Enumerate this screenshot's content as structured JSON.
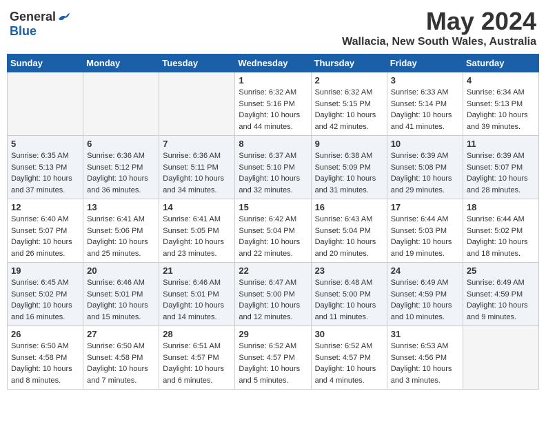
{
  "header": {
    "logo_general": "General",
    "logo_blue": "Blue",
    "month_title": "May 2024",
    "location": "Wallacia, New South Wales, Australia"
  },
  "calendar": {
    "days_of_week": [
      "Sunday",
      "Monday",
      "Tuesday",
      "Wednesday",
      "Thursday",
      "Friday",
      "Saturday"
    ],
    "weeks": [
      [
        {
          "day": "",
          "info": ""
        },
        {
          "day": "",
          "info": ""
        },
        {
          "day": "",
          "info": ""
        },
        {
          "day": "1",
          "info": "Sunrise: 6:32 AM\nSunset: 5:16 PM\nDaylight: 10 hours\nand 44 minutes."
        },
        {
          "day": "2",
          "info": "Sunrise: 6:32 AM\nSunset: 5:15 PM\nDaylight: 10 hours\nand 42 minutes."
        },
        {
          "day": "3",
          "info": "Sunrise: 6:33 AM\nSunset: 5:14 PM\nDaylight: 10 hours\nand 41 minutes."
        },
        {
          "day": "4",
          "info": "Sunrise: 6:34 AM\nSunset: 5:13 PM\nDaylight: 10 hours\nand 39 minutes."
        }
      ],
      [
        {
          "day": "5",
          "info": "Sunrise: 6:35 AM\nSunset: 5:13 PM\nDaylight: 10 hours\nand 37 minutes."
        },
        {
          "day": "6",
          "info": "Sunrise: 6:36 AM\nSunset: 5:12 PM\nDaylight: 10 hours\nand 36 minutes."
        },
        {
          "day": "7",
          "info": "Sunrise: 6:36 AM\nSunset: 5:11 PM\nDaylight: 10 hours\nand 34 minutes."
        },
        {
          "day": "8",
          "info": "Sunrise: 6:37 AM\nSunset: 5:10 PM\nDaylight: 10 hours\nand 32 minutes."
        },
        {
          "day": "9",
          "info": "Sunrise: 6:38 AM\nSunset: 5:09 PM\nDaylight: 10 hours\nand 31 minutes."
        },
        {
          "day": "10",
          "info": "Sunrise: 6:39 AM\nSunset: 5:08 PM\nDaylight: 10 hours\nand 29 minutes."
        },
        {
          "day": "11",
          "info": "Sunrise: 6:39 AM\nSunset: 5:07 PM\nDaylight: 10 hours\nand 28 minutes."
        }
      ],
      [
        {
          "day": "12",
          "info": "Sunrise: 6:40 AM\nSunset: 5:07 PM\nDaylight: 10 hours\nand 26 minutes."
        },
        {
          "day": "13",
          "info": "Sunrise: 6:41 AM\nSunset: 5:06 PM\nDaylight: 10 hours\nand 25 minutes."
        },
        {
          "day": "14",
          "info": "Sunrise: 6:41 AM\nSunset: 5:05 PM\nDaylight: 10 hours\nand 23 minutes."
        },
        {
          "day": "15",
          "info": "Sunrise: 6:42 AM\nSunset: 5:04 PM\nDaylight: 10 hours\nand 22 minutes."
        },
        {
          "day": "16",
          "info": "Sunrise: 6:43 AM\nSunset: 5:04 PM\nDaylight: 10 hours\nand 20 minutes."
        },
        {
          "day": "17",
          "info": "Sunrise: 6:44 AM\nSunset: 5:03 PM\nDaylight: 10 hours\nand 19 minutes."
        },
        {
          "day": "18",
          "info": "Sunrise: 6:44 AM\nSunset: 5:02 PM\nDaylight: 10 hours\nand 18 minutes."
        }
      ],
      [
        {
          "day": "19",
          "info": "Sunrise: 6:45 AM\nSunset: 5:02 PM\nDaylight: 10 hours\nand 16 minutes."
        },
        {
          "day": "20",
          "info": "Sunrise: 6:46 AM\nSunset: 5:01 PM\nDaylight: 10 hours\nand 15 minutes."
        },
        {
          "day": "21",
          "info": "Sunrise: 6:46 AM\nSunset: 5:01 PM\nDaylight: 10 hours\nand 14 minutes."
        },
        {
          "day": "22",
          "info": "Sunrise: 6:47 AM\nSunset: 5:00 PM\nDaylight: 10 hours\nand 12 minutes."
        },
        {
          "day": "23",
          "info": "Sunrise: 6:48 AM\nSunset: 5:00 PM\nDaylight: 10 hours\nand 11 minutes."
        },
        {
          "day": "24",
          "info": "Sunrise: 6:49 AM\nSunset: 4:59 PM\nDaylight: 10 hours\nand 10 minutes."
        },
        {
          "day": "25",
          "info": "Sunrise: 6:49 AM\nSunset: 4:59 PM\nDaylight: 10 hours\nand 9 minutes."
        }
      ],
      [
        {
          "day": "26",
          "info": "Sunrise: 6:50 AM\nSunset: 4:58 PM\nDaylight: 10 hours\nand 8 minutes."
        },
        {
          "day": "27",
          "info": "Sunrise: 6:50 AM\nSunset: 4:58 PM\nDaylight: 10 hours\nand 7 minutes."
        },
        {
          "day": "28",
          "info": "Sunrise: 6:51 AM\nSunset: 4:57 PM\nDaylight: 10 hours\nand 6 minutes."
        },
        {
          "day": "29",
          "info": "Sunrise: 6:52 AM\nSunset: 4:57 PM\nDaylight: 10 hours\nand 5 minutes."
        },
        {
          "day": "30",
          "info": "Sunrise: 6:52 AM\nSunset: 4:57 PM\nDaylight: 10 hours\nand 4 minutes."
        },
        {
          "day": "31",
          "info": "Sunrise: 6:53 AM\nSunset: 4:56 PM\nDaylight: 10 hours\nand 3 minutes."
        },
        {
          "day": "",
          "info": ""
        }
      ]
    ]
  }
}
